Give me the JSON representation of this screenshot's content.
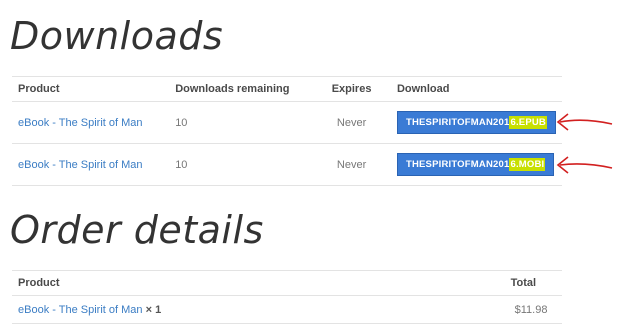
{
  "downloads": {
    "title": "Downloads",
    "columns": [
      "Product",
      "Downloads remaining",
      "Expires",
      "Download"
    ],
    "rows": [
      {
        "product": "eBook - The Spirit of Man",
        "remaining": "10",
        "expires": "Never",
        "file_base": "THESPIRITOFMAN201",
        "file_ext": "6.EPUB"
      },
      {
        "product": "eBook - The Spirit of Man",
        "remaining": "10",
        "expires": "Never",
        "file_base": "THESPIRITOFMAN201",
        "file_ext": "6.MOBI"
      }
    ]
  },
  "order": {
    "title": "Order details",
    "columns": [
      "Product",
      "Total"
    ],
    "rows": [
      {
        "product": "eBook - The Spirit of Man",
        "qty": "× 1",
        "total": "$11.98"
      }
    ]
  },
  "colors": {
    "link": "#3b7dc4",
    "button": "#3a7bd5",
    "highlight": "#c8e000",
    "annotation_arrow": "#d22020"
  },
  "icons": [
    "red-arrow-annotation-icon"
  ]
}
